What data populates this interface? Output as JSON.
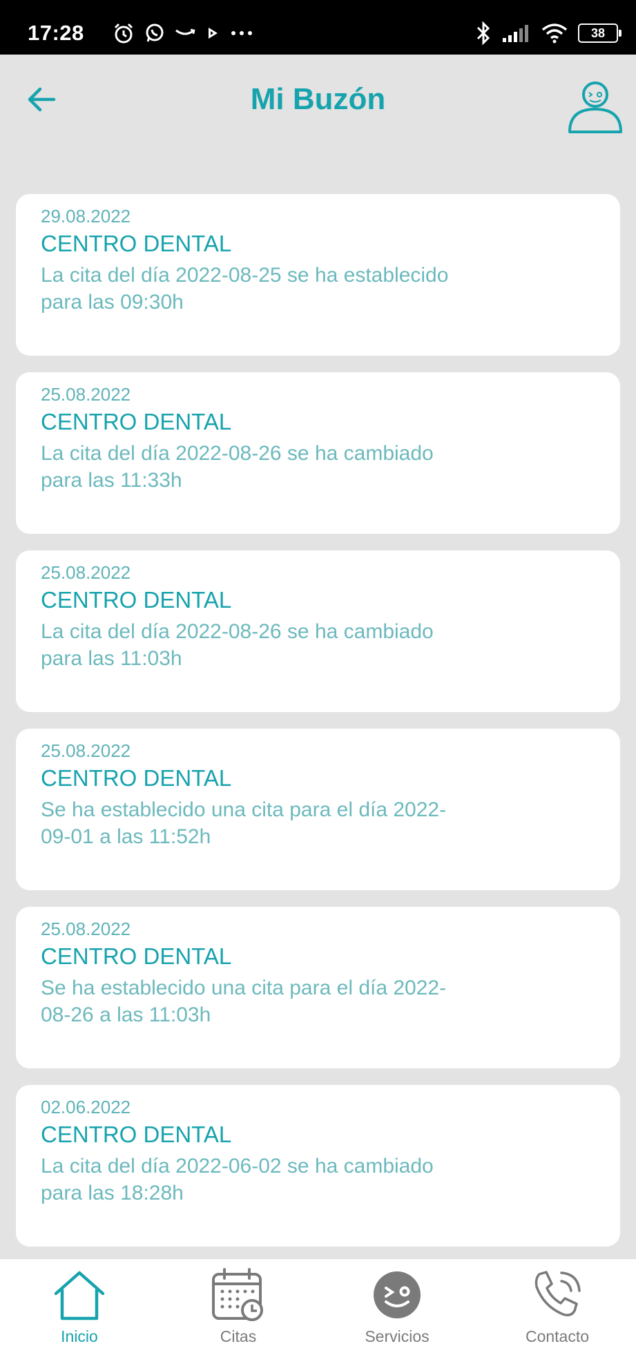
{
  "status_bar": {
    "time": "17:28",
    "battery": "38",
    "left_icons": [
      "alarm-icon",
      "whatsapp-icon",
      "amazon-icon",
      "play-icon",
      "more-icon"
    ],
    "right_icons": [
      "bluetooth-icon",
      "signal-icon",
      "wifi-icon",
      "battery-icon"
    ]
  },
  "header": {
    "title": "Mi Buzón",
    "back_icon": "arrow-left-icon",
    "profile_icon": "user-profile-icon"
  },
  "colors": {
    "accent": "#17a3ad",
    "text_light": "#6cb9bd",
    "background": "#e3e3e3",
    "card": "#ffffff",
    "nav_inactive": "#7a7a7a"
  },
  "messages": [
    {
      "date": "29.08.2022",
      "sender": "CENTRO DENTAL",
      "text": "La cita del día 2022-08-25 se ha establecido para las 09:30h"
    },
    {
      "date": "25.08.2022",
      "sender": "CENTRO DENTAL",
      "text": "La cita del día 2022-08-26 se ha cambiado para las 11:33h"
    },
    {
      "date": "25.08.2022",
      "sender": "CENTRO DENTAL",
      "text": "La cita del día 2022-08-26 se ha cambiado para las 11:03h"
    },
    {
      "date": "25.08.2022",
      "sender": "CENTRO DENTAL",
      "text": "Se ha establecido una cita para el día 2022-09-01 a las 11:52h"
    },
    {
      "date": "25.08.2022",
      "sender": "CENTRO DENTAL",
      "text": "Se ha establecido una cita para el día 2022-08-26 a las 11:03h"
    },
    {
      "date": "02.06.2022",
      "sender": "CENTRO DENTAL",
      "text": "La cita del día 2022-06-02 se ha cambiado para las 18:28h"
    }
  ],
  "bottom_nav": [
    {
      "label": "Inicio",
      "icon": "home-icon",
      "active": true
    },
    {
      "label": "Citas",
      "icon": "calendar-clock-icon",
      "active": false
    },
    {
      "label": "Servicios",
      "icon": "smiley-wink-icon",
      "active": false
    },
    {
      "label": "Contacto",
      "icon": "phone-icon",
      "active": false
    }
  ]
}
